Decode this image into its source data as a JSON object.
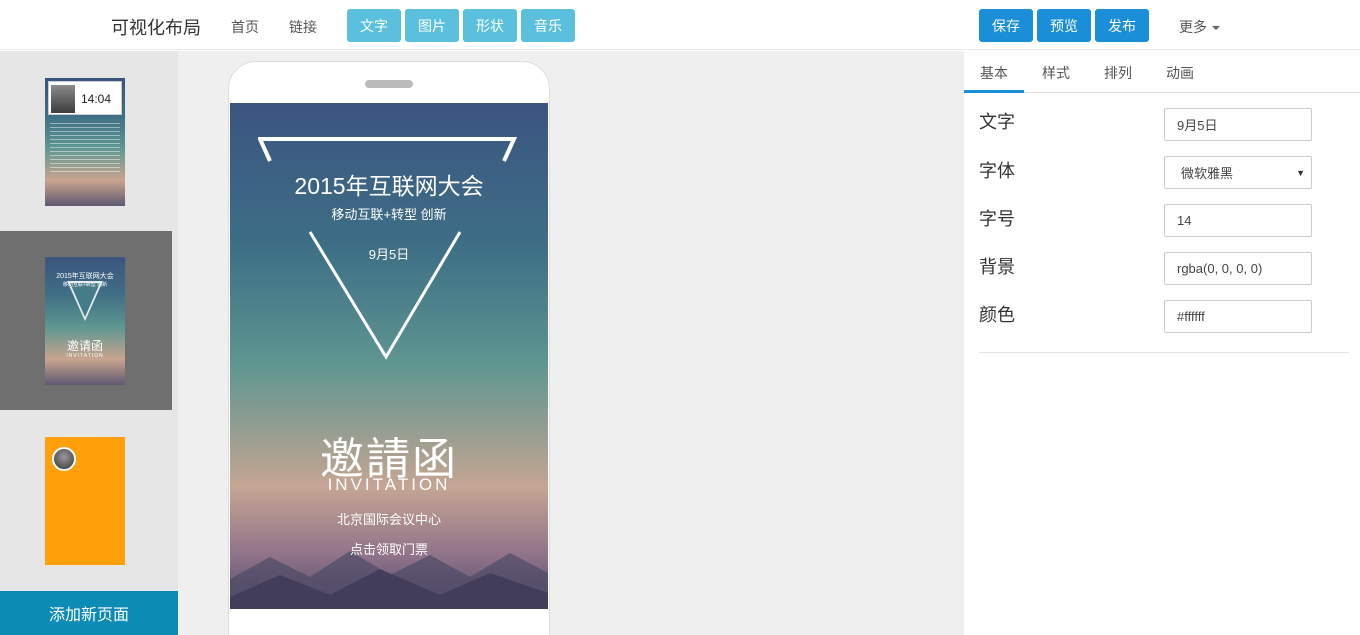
{
  "app": {
    "brand": "可视化布局"
  },
  "nav": {
    "home": "首页",
    "link": "链接"
  },
  "toolbar": {
    "text": "文字",
    "image": "图片",
    "shape": "形状",
    "music": "音乐"
  },
  "actions": {
    "save": "保存",
    "preview": "预览",
    "publish": "发布",
    "more": "更多"
  },
  "sidebar": {
    "add_page": "添加新页面",
    "thumb1": {
      "time": "14:04"
    },
    "thumb2": {
      "title": "2015年互联网大会",
      "subtitle": "移动互联+转型 创新",
      "invite": "邀请函",
      "invite_en": "INVITATION"
    }
  },
  "slide": {
    "title": "2015年互联网大会",
    "subtitle": "移动互联+转型 创新",
    "date": "9月5日",
    "invite": "邀請函",
    "invite_en": "INVITATION",
    "venue": "北京国际会议中心",
    "ticket": "点击领取门票"
  },
  "panel": {
    "tabs": [
      "基本",
      "样式",
      "排列",
      "动画"
    ],
    "active_tab": "基本",
    "fields": {
      "text": {
        "label": "文字",
        "value": "9月5日"
      },
      "font": {
        "label": "字体",
        "value": "微软雅黑"
      },
      "size": {
        "label": "字号",
        "value": "14"
      },
      "background": {
        "label": "背景",
        "value": "rgba(0, 0, 0, 0)"
      },
      "color": {
        "label": "颜色",
        "value": "#ffffff"
      }
    }
  },
  "colors": {
    "tool_button": "#5bc0de",
    "action_button": "#1a8fd8",
    "add_page": "#0c8bb5",
    "thumb3_bg": "#ff9f0a"
  }
}
